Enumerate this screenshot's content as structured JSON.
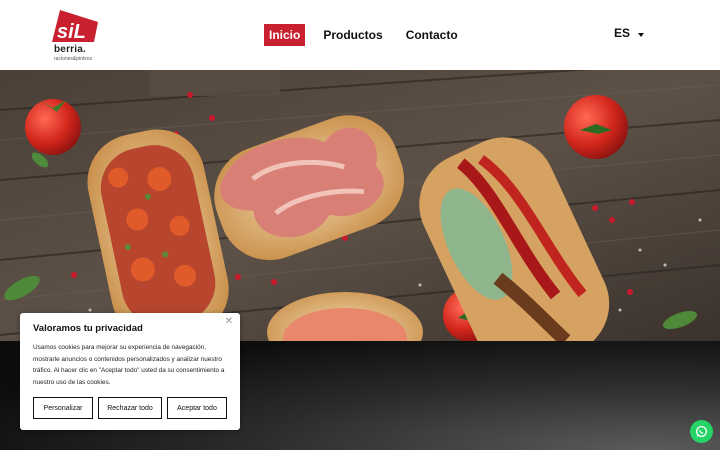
{
  "brand": {
    "logo_text": "siL",
    "name": "berria.",
    "tagline": "raciones&pintxos"
  },
  "nav": {
    "items": [
      {
        "label": "Inicio",
        "active": true
      },
      {
        "label": "Productos",
        "active": false
      },
      {
        "label": "Contacto",
        "active": false
      }
    ]
  },
  "language": {
    "selected": "ES",
    "icon": "chevron-down-icon"
  },
  "hero": {
    "image": "pintxos-on-wooden-board"
  },
  "cookie_banner": {
    "title": "Valoramos tu privacidad",
    "text": "Usamos cookies para mejorar su experiencia de navegación, mostrarle anuncios o contenidos personalizados y analizar nuestro tráfico. Al hacer clic en \"Aceptar todo\" usted da su consentimiento a nuestro uso de las cookies.",
    "close_icon": "close-icon",
    "buttons": {
      "customize": "Personalizar",
      "reject": "Rechazar todo",
      "accept": "Aceptar todo"
    }
  },
  "whatsapp": {
    "icon": "whatsapp-icon"
  },
  "colors": {
    "brand_red": "#c8202f",
    "whatsapp_green": "#25d366"
  }
}
